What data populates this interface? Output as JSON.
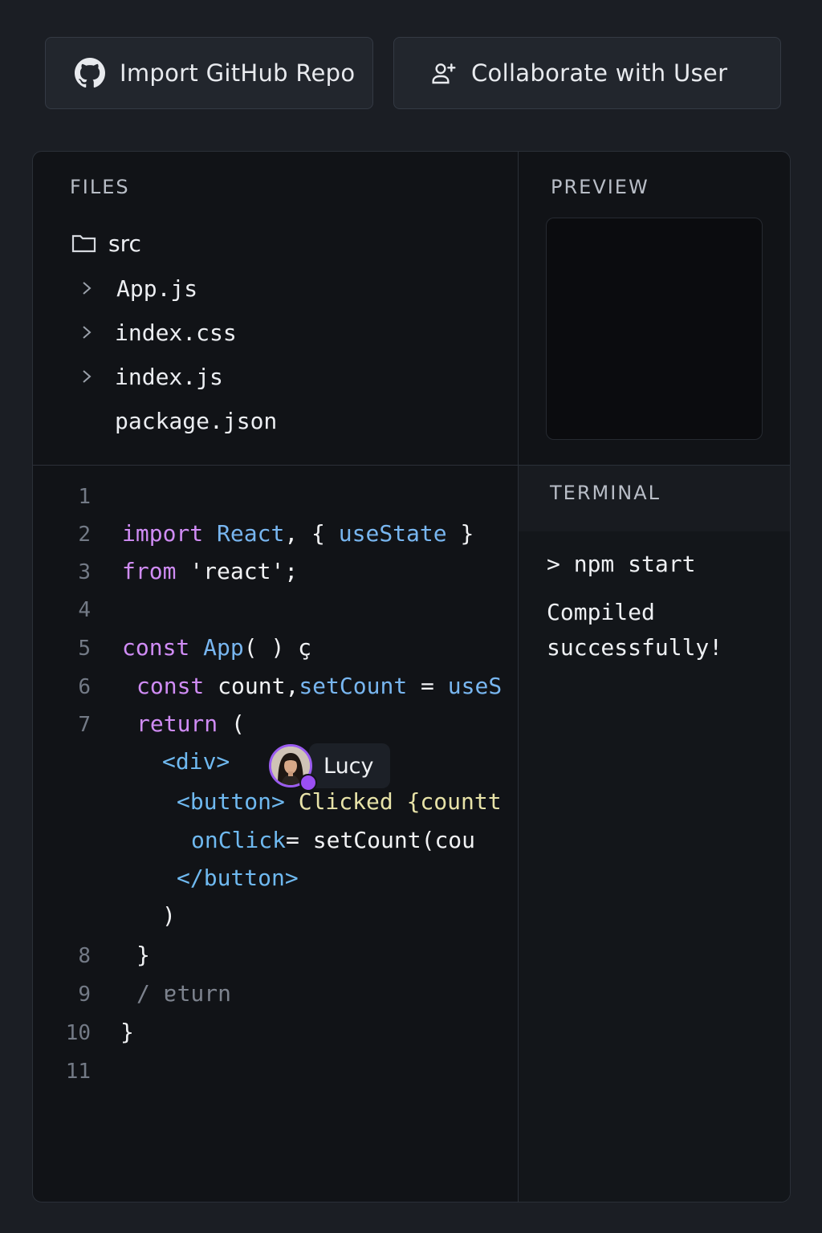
{
  "toolbar": {
    "import_label": "Import GitHub Repo",
    "import_icon": "github-icon",
    "collab_label": "Collaborate with User",
    "collab_icon": "add-user-icon"
  },
  "files": {
    "title": "FILES",
    "folder": "src",
    "items": [
      "App.js",
      "index.css",
      "index.js",
      "package.json"
    ]
  },
  "preview": {
    "title": "PREVIEW"
  },
  "terminal": {
    "title": "TERMINAL",
    "command": "> npm start",
    "output_line1": "Compiled",
    "output_line2": "successfully!"
  },
  "editor": {
    "line_numbers": [
      "1",
      "2",
      "3",
      "4",
      "5",
      "6",
      "7",
      "8",
      "9",
      "10",
      "11"
    ],
    "lines": {
      "l2": [
        "import",
        " React",
        ", { ",
        "useState",
        " }"
      ],
      "l3": [
        "from",
        " 'react';"
      ],
      "l5": [
        "const",
        " App",
        "( ) ç"
      ],
      "l6": [
        "const",
        " count,",
        "setCount",
        " = ",
        "useS"
      ],
      "l7": [
        "return",
        " ("
      ],
      "w1": [
        "<div>"
      ],
      "w2": [
        "<button>",
        " Clicked",
        " {countt"
      ],
      "w3": [
        "onClick",
        "= setCount(cou"
      ],
      "w4": [
        "</button>"
      ],
      "w5": [
        ")"
      ],
      "l8": [
        "}"
      ],
      "l9": [
        "/ ",
        "ɐturn"
      ],
      "l10": [
        "}"
      ]
    },
    "collaborator": {
      "name": "Lucy",
      "color": "#9b5cf0"
    }
  }
}
